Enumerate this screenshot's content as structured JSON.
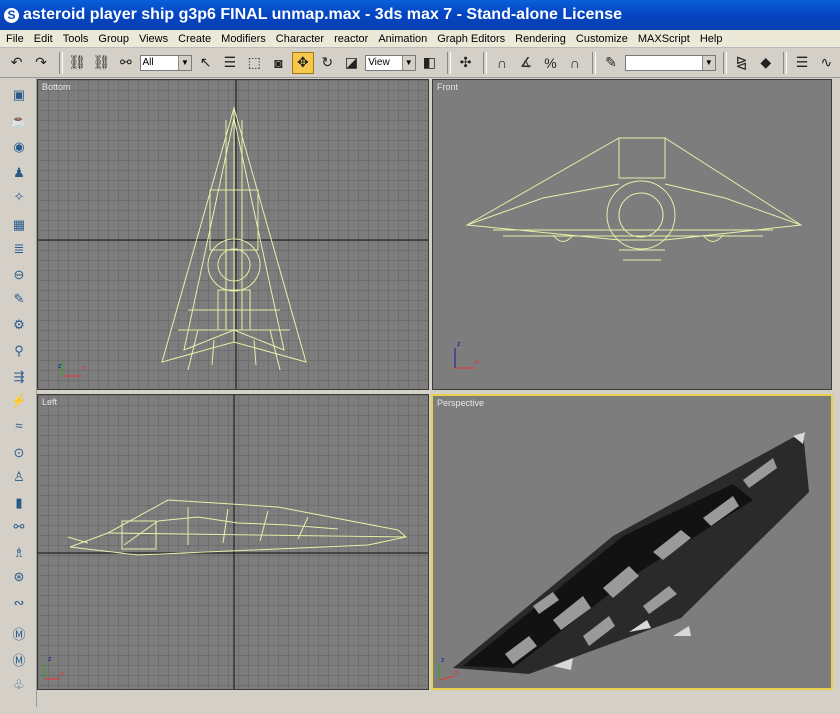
{
  "window": {
    "title": "asteroid player ship g3p6 FINAL unmap.max - 3ds max 7  - Stand-alone License"
  },
  "menu": [
    "File",
    "Edit",
    "Tools",
    "Group",
    "Views",
    "Create",
    "Modifiers",
    "Character",
    "reactor",
    "Animation",
    "Graph Editors",
    "Rendering",
    "Customize",
    "MAXScript",
    "Help"
  ],
  "toolbar": {
    "selection_filter": "All",
    "reference_coord": "View"
  },
  "viewports": {
    "top_left": "Bottom",
    "top_right": "Front",
    "bottom_left": "Left",
    "bottom_right": "Perspective"
  },
  "status": {
    "value": ""
  }
}
